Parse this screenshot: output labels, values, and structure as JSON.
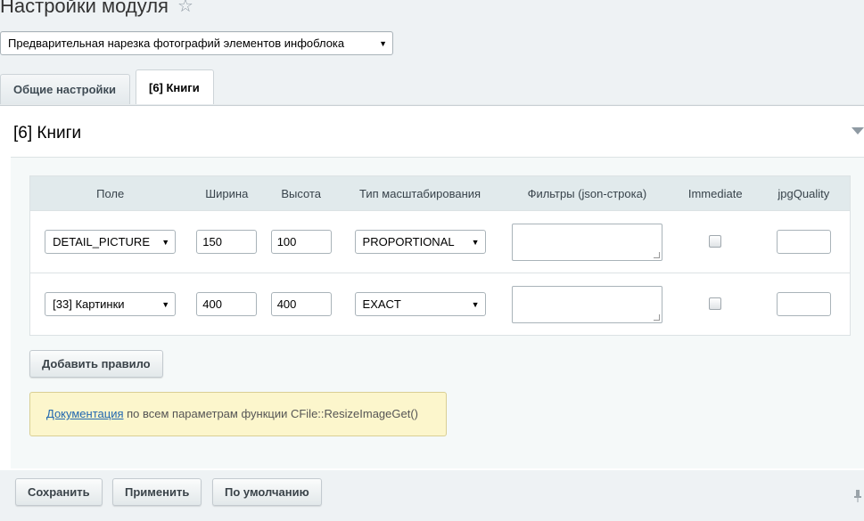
{
  "header": {
    "title": "Настройки модуля",
    "star_icon": "☆"
  },
  "module_select": {
    "value": "Предварительная нарезка фотографий элементов инфоблока"
  },
  "tabs": [
    {
      "label": "Общие настройки",
      "active": false
    },
    {
      "label": "[6] Книги",
      "active": true
    }
  ],
  "section": {
    "title": "[6] Книги"
  },
  "table": {
    "headers": [
      "Поле",
      "Ширина",
      "Высота",
      "Тип масштабирования",
      "Фильтры (json-строка)",
      "Immediate",
      "jpgQuality"
    ],
    "rows": [
      {
        "field": "DETAIL_PICTURE",
        "width": "150",
        "height": "100",
        "scale_type": "PROPORTIONAL",
        "filters": "",
        "immediate": false,
        "jpg_quality": ""
      },
      {
        "field": "[33] Картинки",
        "width": "400",
        "height": "400",
        "scale_type": "EXACT",
        "filters": "",
        "immediate": false,
        "jpg_quality": ""
      }
    ]
  },
  "add_rule_label": "Добавить правило",
  "note": {
    "link_text": "Документация",
    "text": " по всем параметрам функции CFile::ResizeImageGet()"
  },
  "footer": {
    "save_label": "Сохранить",
    "apply_label": "Применить",
    "default_label": "По умолчанию"
  },
  "colors": {
    "note_bg": "#fcf6cc",
    "link": "#2067b0",
    "header_bg": "#e1eaec"
  },
  "icons": {
    "star": "star-icon",
    "dropdown": "chevron-down-icon",
    "collapse": "triangle-down-icon",
    "pin": "pin-icon"
  }
}
